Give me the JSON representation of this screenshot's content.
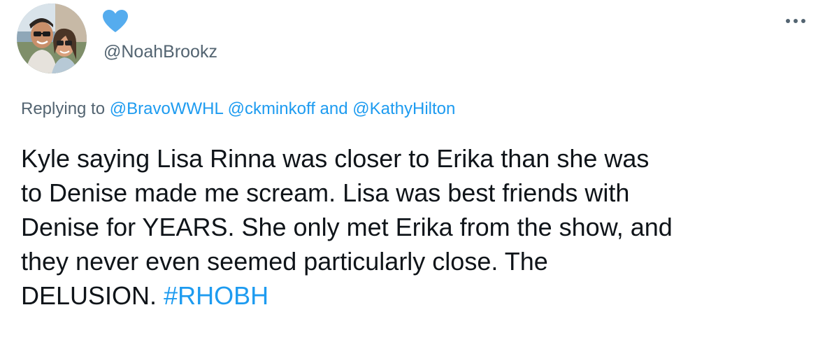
{
  "author": {
    "handle": "@NoahBrookz",
    "display_name_icon": "heart-icon",
    "heart_color": "#55acee"
  },
  "menu": {
    "icon": "more-horizontal-icon"
  },
  "reply": {
    "prefix": "Replying to",
    "mention_1": "@BravoWWHL",
    "mention_2": "@ckminkoff",
    "conjunction": "and",
    "mention_3": "@KathyHilton"
  },
  "tweet": {
    "lines": [
      "Kyle saying Lisa Rinna was closer to Erika than she was",
      "to Denise made me scream. Lisa was best friends with",
      "Denise for YEARS. She only met Erika from the show, and",
      "they never even seemed particularly close. The"
    ],
    "last_line_text": "DELUSION.",
    "hashtag": "#RHOBH"
  },
  "colors": {
    "link": "#1d9bf0",
    "secondary_text": "#536471",
    "primary_text": "#0f1419"
  }
}
